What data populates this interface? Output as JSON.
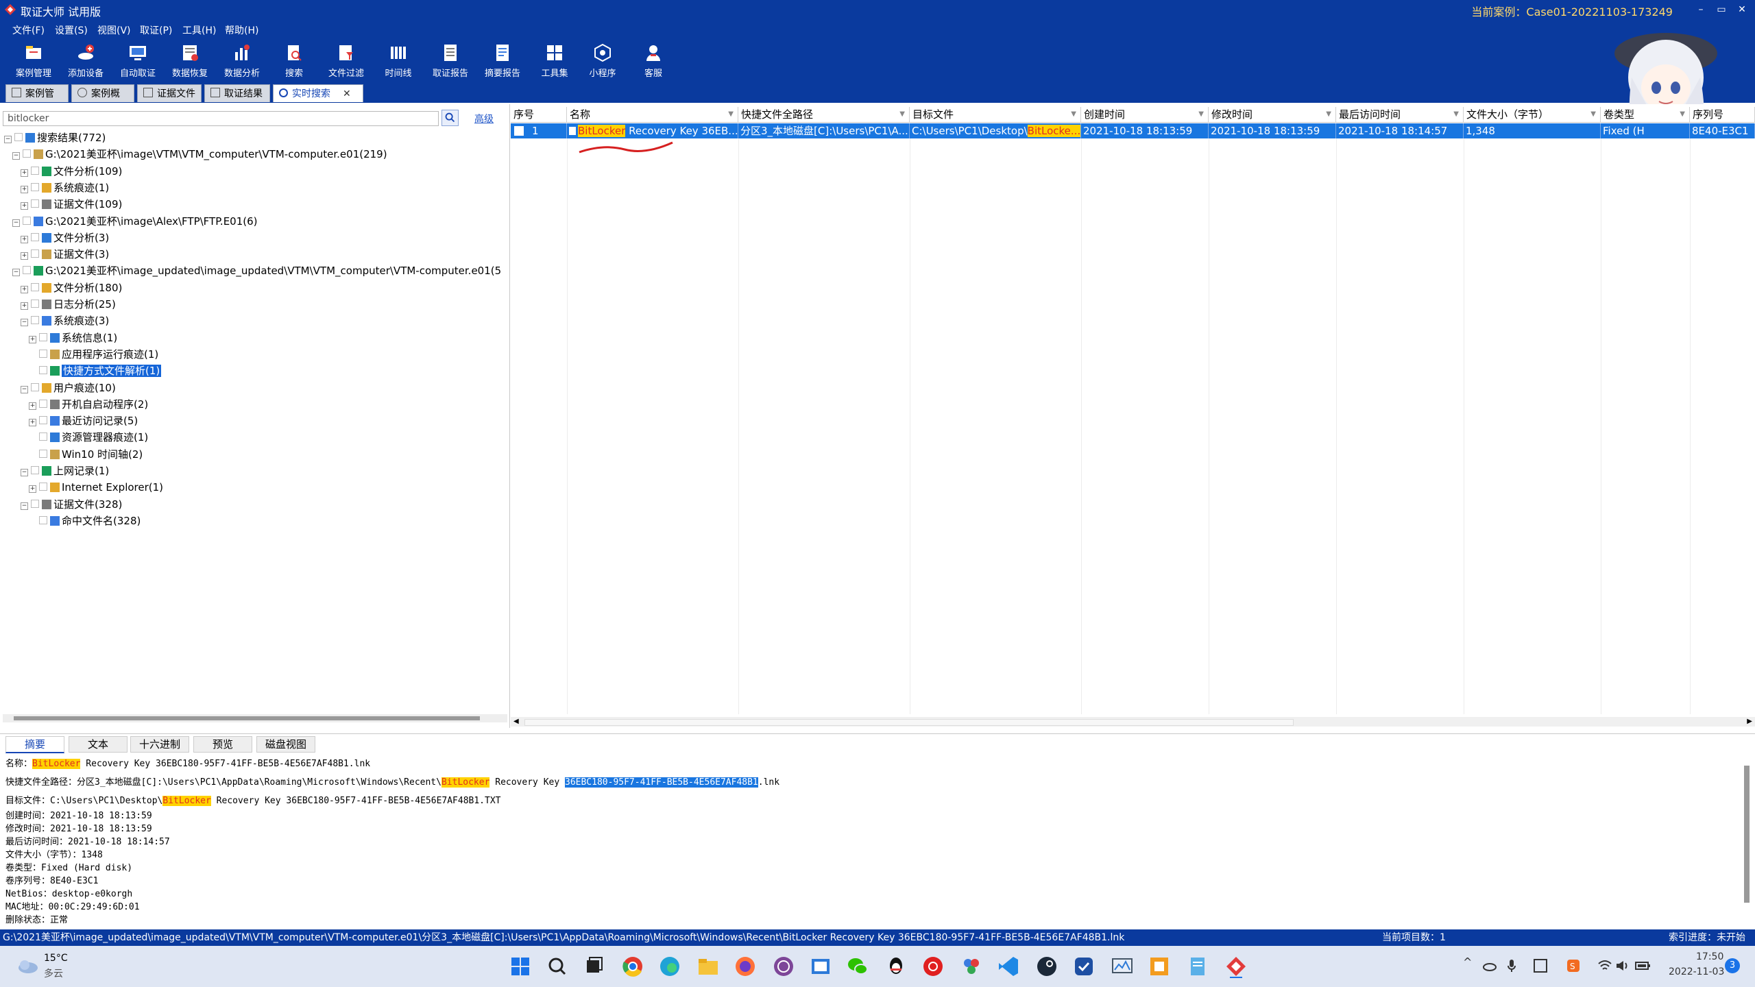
{
  "window": {
    "title": "取证大师 试用版",
    "current_case": "当前案例：Case01-20221103-173249",
    "controls": [
      "–",
      "▭",
      "✕"
    ]
  },
  "menu": [
    "文件(F)",
    "设置(S)",
    "视图(V)",
    "取证(P)",
    "工具(H)",
    "帮助(H)"
  ],
  "toolbar": [
    "案例管理",
    "添加设备",
    "自动取证",
    "数据恢复",
    "数据分析",
    "搜索",
    "文件过滤",
    "时间线",
    "取证报告",
    "摘要报告",
    "工具集",
    "小程序",
    "客服"
  ],
  "tabs": [
    {
      "label": "案例管理"
    },
    {
      "label": "案例概览"
    },
    {
      "label": "证据文件"
    },
    {
      "label": "取证结果"
    },
    {
      "label": "实时搜索"
    }
  ],
  "search": {
    "value": "bitlocker",
    "advanced": "高级"
  },
  "tree": [
    {
      "text": "搜索结果(772)",
      "indent": 0,
      "exp": "−"
    },
    {
      "text": "G:\\2021美亚杯\\image\\VTM\\VTM_computer\\VTM-computer.e01(219)",
      "indent": 1,
      "exp": "−"
    },
    {
      "text": "文件分析(109)",
      "indent": 2,
      "exp": "+"
    },
    {
      "text": "系统痕迹(1)",
      "indent": 2,
      "exp": "+"
    },
    {
      "text": "证据文件(109)",
      "indent": 2,
      "exp": "+"
    },
    {
      "text": "G:\\2021美亚杯\\image\\Alex\\FTP\\FTP.E01(6)",
      "indent": 1,
      "exp": "−"
    },
    {
      "text": "文件分析(3)",
      "indent": 2,
      "exp": "+"
    },
    {
      "text": "证据文件(3)",
      "indent": 2,
      "exp": "+"
    },
    {
      "text": "G:\\2021美亚杯\\image_updated\\image_updated\\VTM\\VTM_computer\\VTM-computer.e01(5",
      "indent": 1,
      "exp": "−"
    },
    {
      "text": "文件分析(180)",
      "indent": 2,
      "exp": "+"
    },
    {
      "text": "日志分析(25)",
      "indent": 2,
      "exp": "+"
    },
    {
      "text": "系统痕迹(3)",
      "indent": 2,
      "exp": "−"
    },
    {
      "text": "系统信息(1)",
      "indent": 3,
      "exp": "+"
    },
    {
      "text": "应用程序运行痕迹(1)",
      "indent": 3,
      "exp": ""
    },
    {
      "text": "快捷方式文件解析(1)",
      "indent": 3,
      "exp": "",
      "selected": true
    },
    {
      "text": "用户痕迹(10)",
      "indent": 2,
      "exp": "−"
    },
    {
      "text": "开机自启动程序(2)",
      "indent": 3,
      "exp": "+"
    },
    {
      "text": "最近访问记录(5)",
      "indent": 3,
      "exp": "+"
    },
    {
      "text": "资源管理器痕迹(1)",
      "indent": 3,
      "exp": ""
    },
    {
      "text": "Win10 时间轴(2)",
      "indent": 3,
      "exp": ""
    },
    {
      "text": "上网记录(1)",
      "indent": 2,
      "exp": "−"
    },
    {
      "text": "Internet Explorer(1)",
      "indent": 3,
      "exp": "+"
    },
    {
      "text": "证据文件(328)",
      "indent": 2,
      "exp": "−"
    },
    {
      "text": "命中文件名(328)",
      "indent": 3,
      "exp": ""
    }
  ],
  "grid": {
    "columns": [
      "序号",
      "名称",
      "快捷文件全路径",
      "目标文件",
      "创建时间",
      "修改时间",
      "最后访问时间",
      "文件大小（字节）",
      "卷类型",
      "序列号"
    ],
    "row": {
      "index": "1",
      "name_hl": "BitLocker",
      "name_rest": " Recovery Key 36EB...",
      "path": "分区3_本地磁盘[C]:\\Users\\PC1\\A...",
      "target_pre": "C:\\Users\\PC1\\Desktop\\",
      "target_hl": "BitLocke...",
      "created": "2021-10-18 18:13:59",
      "modified": "2021-10-18 18:13:59",
      "accessed": "2021-10-18 18:14:57",
      "size": "1,348",
      "voltype": "Fixed (H",
      "serial": "8E40-E3C1"
    }
  },
  "bottom_tabs": [
    "摘要",
    "文本",
    "十六进制",
    "预览",
    "磁盘视图"
  ],
  "detail": {
    "name_label": "名称：",
    "name_hl": "BitLocker",
    "name_rest": " Recovery Key 36EBC180-95F7-41FF-BE5B-4E56E7AF48B1.lnk",
    "path_label": "快捷文件全路径：",
    "path_pre": "分区3_本地磁盘[C]:\\Users\\PC1\\AppData\\Roaming\\Microsoft\\Windows\\Recent\\",
    "path_hl": "BitLocker",
    "path_mid": " Recovery Key ",
    "path_sel": "36EBC180-95F7-41FF-BE5B-4E56E7AF48B1",
    "path_end": ".lnk",
    "target_label": "目标文件：",
    "target_pre": "C:\\Users\\PC1\\Desktop\\",
    "target_hl": "BitLocker",
    "target_rest": " Recovery Key 36EBC180-95F7-41FF-BE5B-4E56E7AF48B1.TXT",
    "lines": [
      "创建时间：2021-10-18 18:13:59",
      "修改时间：2021-10-18 18:13:59",
      "最后访问时间：2021-10-18 18:14:57",
      "文件大小（字节）：1348",
      "卷类型：Fixed (Hard disk)",
      "卷序列号：8E40-E3C1",
      "NetBios：desktop-e0korgh",
      "MAC地址：00:0C:29:49:6D:01",
      "删除状态：正常"
    ]
  },
  "status": {
    "path": "G:\\2021美亚杯\\image_updated\\image_updated\\VTM\\VTM_computer\\VTM-computer.e01\\分区3_本地磁盘[C]:\\Users\\PC1\\AppData\\Roaming\\Microsoft\\Windows\\Recent\\BitLocker Recovery Key 36EBC180-95F7-41FF-BE5B-4E56E7AF48B1.lnk",
    "count": "当前项目数：1",
    "index": "索引进度：未开始"
  },
  "taskbar": {
    "temp": "15°C",
    "weather": "多云",
    "time": "17:50",
    "date": "2022-11-03",
    "notif": "3"
  },
  "colors": {
    "brand": "#0a3a9e",
    "selection": "#1976e0",
    "highlight": "#ffd200"
  }
}
